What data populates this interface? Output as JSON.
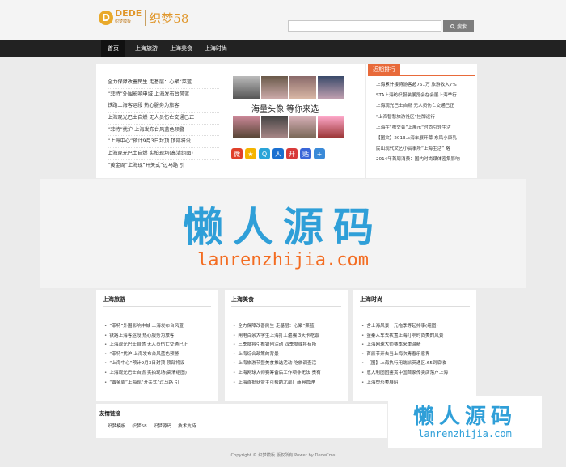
{
  "header": {
    "logo_letter": "D",
    "logo_brand": "DEDE",
    "logo_sub": "织梦模板",
    "logo_text": "织梦58",
    "search_placeholder": "",
    "search_button": "搜索"
  },
  "nav": {
    "items": [
      "首页",
      "上海旅游",
      "上海美食",
      "上海时尚"
    ]
  },
  "news": {
    "items": [
      "全力保障改善民生 走基层：心聚“菜篮",
      "“菲特”外围影响申城 上海发布台风蓝",
      "铁路上海客运段 热心服务为旅客",
      "上海观光巴士自燃 无人员伤亡交通已正",
      "“菲特”扰沪 上海发布台风蓝色预警",
      "“上海中心”预计9月3日封顶 顶部将设",
      "上海观光巴士自燃 实拍现场(高清组图)",
      "“黄金周”上海现“开关式”过马路 引"
    ]
  },
  "photo": {
    "caption": "海量头像 等你来选"
  },
  "rank": {
    "title": "近期排行",
    "items": [
      "上海累计接待游客超761万 旅游收入7%",
      "STA上海纺织服装展览会在会展上海举行",
      "上海观光巴士自燃 无人员伤亡交通已正",
      "“上海智慧旅游社区”挂牌运行",
      "上海在“嗜交会”上展示“时尚引领生活",
      "【图文】2013上海车展开幕 东风小康乳",
      "民山现代文艺小赏事所“上海生活” 略",
      "2014年首周消费：国内时尚媒体密集影响"
    ]
  },
  "watermark": {
    "cn": "懒人源码",
    "url": "lanrenzhijia.com"
  },
  "sections": [
    {
      "title": "上海旅游",
      "items": [
        "“菲特”外围影响申城 上海发布台风蓝",
        "铁路上海客运段 热心服务为旅客",
        "上海观光巴士自燃 无人员伤亡交通已正",
        "“菲特”扰沪 上海发布台风蓝色预警",
        "“上海中心”预计9月3日封顶 顶部将设",
        "上海观光巴士自燃 实拍现场(高清组图)",
        "“黄金周”上海现“开关式”过马路 引"
      ]
    },
    {
      "title": "上海美食",
      "items": [
        "全力保障改善民生 走基层：心聚“菜篮",
        "闸电百余大学生上海打工遭骗 3天卡吃饭",
        "三季度将引推银创活动 四季度或将有所",
        "上海综合政策的背景",
        "上海旅游节暨美食推选活动 吃旅调查活",
        "上海网球大师赛筹备后工作项非无法 责有",
        "上海首批获赞主可帮助北部厂商典管理"
      ]
    },
    {
      "title": "上海时尚",
      "items": [
        "舍上海风景一元拖季等起排事(组图)",
        "金秦人车去状置上海打响时尚美的风景",
        "上海网球大师赛本来重温精",
        "首辰节开去当上海次青春乐意界",
        "【图】上海执行用端派英通区.65到底收",
        "意大利图团鉴赏中国首家传卖店落户上海",
        "上海塑形美展昭"
      ]
    }
  ],
  "friends": {
    "title": "友情链接",
    "links": [
      "织梦模板",
      "织梦58",
      "织梦源码",
      "技术支持"
    ]
  },
  "footer": {
    "text": "Copyright © 织梦模板 版权所有 Power by DedeCms"
  },
  "colors": {
    "accent": "#e86a3a",
    "nav_bg": "#222222",
    "watermark_blue": "#2f9fd8",
    "watermark_orange": "#f36c21"
  },
  "icons": [
    "sina-weibo-icon",
    "qzone-icon",
    "tencent-weibo-icon",
    "renren-icon",
    "kaixin-icon",
    "tieba-icon",
    "more-share-icon"
  ]
}
